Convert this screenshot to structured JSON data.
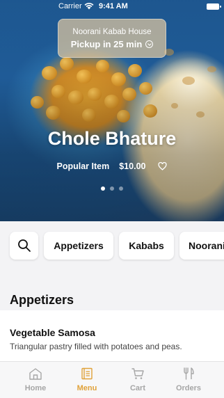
{
  "status_bar": {
    "carrier": "Carrier",
    "time": "9:41 AM"
  },
  "restaurant": {
    "name": "Noorani Kabab House",
    "pickup": "Pickup in 25 min"
  },
  "featured": {
    "title": "Chole Bhature",
    "tag": "Popular Item",
    "price": "$10.00",
    "slide_count": 3,
    "active_slide": 1
  },
  "categories": [
    "Appetizers",
    "Kababs",
    "Noorani"
  ],
  "menu": {
    "section_title": "Appetizers",
    "items": [
      {
        "name": "Vegetable Samosa",
        "description": "Triangular pastry filled with potatoes and peas."
      }
    ]
  },
  "tabbar": {
    "home": "Home",
    "menu": "Menu",
    "cart": "Cart",
    "orders": "Orders",
    "active": "Menu"
  },
  "colors": {
    "accent": "#e0a23a",
    "inactive": "#a6a6a6"
  }
}
